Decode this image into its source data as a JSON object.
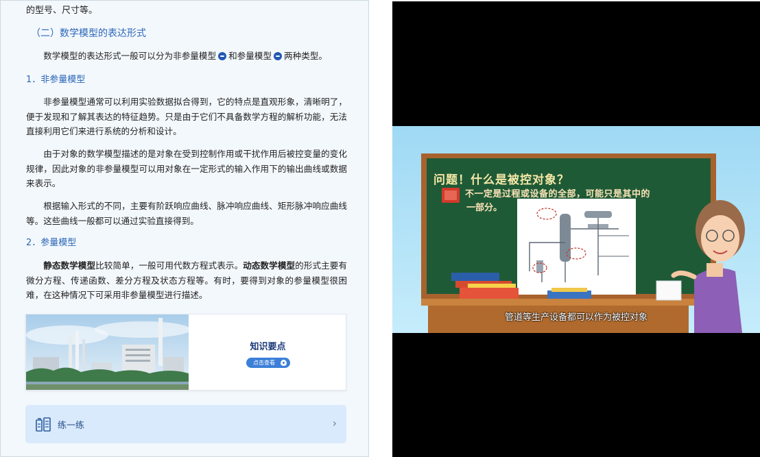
{
  "document": {
    "fragment_top": "的型号、尺寸等。",
    "section_title": "（二）数学模型的表达形式",
    "intro": {
      "part1": "数学模型的表达形式一般可以分为非参量模型",
      "part2": "和参量模型",
      "part3": "两种类型。"
    },
    "subsection1": "1．非参量模型",
    "para1": "非参量模型通常可以利用实验数据拟合得到，它的特点是直观形象，清晰明了，便于发现和了解其表达的特征趋势。只是由于它们不具备数学方程的解析功能，无法直接利用它们来进行系统的分析和设计。",
    "para2": "由于对象的数学模型描述的是对象在受到控制作用或干扰作用后被控变量的变化规律，因此对象的非参量模型可以用对象在一定形式的输入作用下的输出曲线或数据来表示。",
    "para3": "根据输入形式的不同，主要有阶跃响应曲线、脉冲响应曲线、矩形脉冲响应曲线等。这些曲线一般都可以通过实验直接得到。",
    "subsection2": "2．参量模型",
    "para4": {
      "bold1": "静态数学模型",
      "text1": "比较简单，一般可用代数方程式表示。",
      "bold2": "动态数学模型",
      "text2": "的形式主要有微分方程、传递函数、差分方程及状态方程等。有时，要得到对象的参量模型很困难，在这种情况下可采用非参量模型进行描述。"
    },
    "knowledge_card": {
      "title": "知识要点",
      "button": "点击查看"
    },
    "practice": {
      "label": "练一练",
      "icon": "practice-icon",
      "chevron": "›"
    }
  },
  "video": {
    "board_title": "问题！什么是被控对象？",
    "board_line1": "不一定是过程或设备的全部，可能只是其中的",
    "board_line2": "一部分。",
    "subtitle": "管道等生产设备都可以作为被控对象"
  }
}
